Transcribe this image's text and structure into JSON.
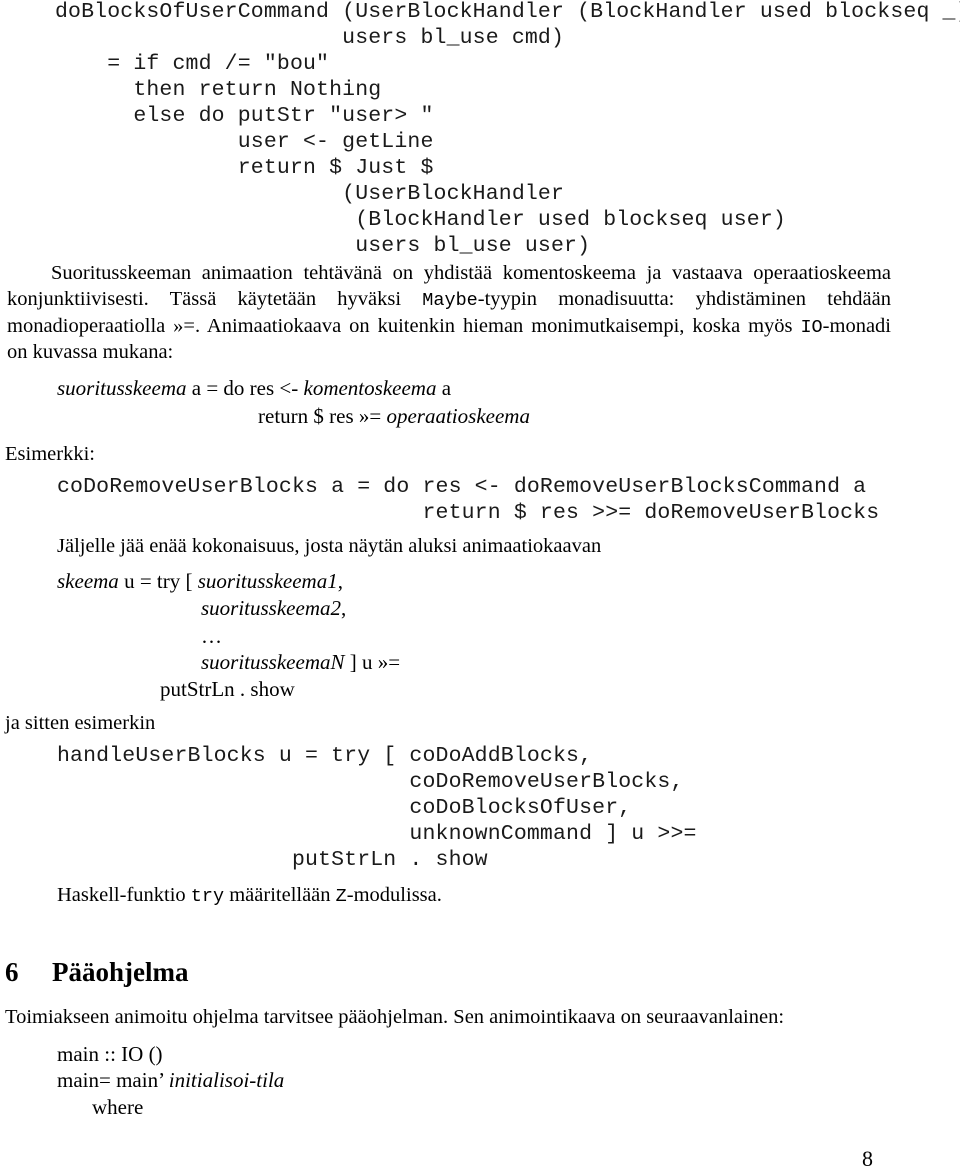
{
  "document": {
    "language": "fi",
    "page_number": "8"
  },
  "code_block_1": {
    "name": "doBlocksOfUserCommand-definition",
    "lines": [
      "doBlocksOfUserCommand (UserBlockHandler (BlockHandler used blockseq _)",
      "                      users bl_use cmd)",
      "    = if cmd /= \"bou\"",
      "      then return Nothing",
      "      else do putStr \"user> \"",
      "              user <- getLine",
      "              return $ Just $",
      "                      (UserBlockHandler",
      "                       (BlockHandler used blockseq user)",
      "                       users bl_use user)"
    ]
  },
  "paragraph_1": {
    "segments": [
      {
        "type": "text",
        "value": "Suoritusskeeman animaation tehtävänä on yhdistää komentoskeema ja vastaava operaatioskeema konjunktiivisesti. Tässä käytetään hyväksi "
      },
      {
        "type": "mono",
        "value": "Maybe"
      },
      {
        "type": "text",
        "value": "-tyypin monadisuutta: yhdistäminen tehdään monadioperaatiolla »=. Animaatiokaava on kuitenkin hieman monimutkaisempi, koska myös "
      },
      {
        "type": "mono",
        "value": "IO"
      },
      {
        "type": "text",
        "value": "-monadi on kuvassa mukana:"
      }
    ],
    "plain": "Suoritusskeeman animaation tehtävänä on yhdistää komentoskeema ja vastaava operaatioskeema konjunktiivisesti. Tässä käytetään hyväksi Maybe-tyypin monadisuutta: yhdistäminen tehdään monadioperaatiolla »=. Animaatiokaava on kuitenkin hieman monimutkaisempi, koska myös IO-monadi on kuvassa mukana:"
  },
  "formula_1": {
    "name": "suoritusskeema-formula",
    "line_1": {
      "part_a_italic": "suoritusskeema",
      "part_b": " a = do res <- ",
      "part_c_italic": "komentoskeema",
      "part_d": " a"
    },
    "line_2": {
      "part_a": "return $ res »= ",
      "part_b_italic": "operaatioskeema"
    }
  },
  "label_esimerkki": "Esimerkki:",
  "code_block_2": {
    "name": "coDoRemoveUserBlocks-example",
    "lines": [
      "coDoRemoveUserBlocks a = do res <- doRemoveUserBlocksCommand a",
      "                            return $ res >>= doRemoveUserBlocks"
    ]
  },
  "paragraph_2": {
    "text": "Jäljelle jää enää kokonaisuus, josta näytän aluksi animaatiokaavan"
  },
  "formula_2": {
    "name": "skeema-formula",
    "lines": [
      {
        "italic_head": "skeema",
        "rest": " u = try [ ",
        "italic_tail": "suoritusskeema1",
        "suffix": ","
      },
      {
        "italic_head": "",
        "rest": "",
        "italic_tail": "suoritusskeema2",
        "suffix": ","
      },
      {
        "italic_head": "",
        "rest": "",
        "italic_tail": "…",
        "suffix": ""
      },
      {
        "italic_head": "",
        "rest": "",
        "italic_tail": "suoritusskeemaN",
        "suffix": " ] u »="
      },
      {
        "italic_head": "",
        "rest": "putStrLn . show",
        "italic_tail": "",
        "suffix": ""
      }
    ]
  },
  "paragraph_3": {
    "text": "ja sitten esimerkin"
  },
  "code_block_3": {
    "name": "handleUserBlocks-example",
    "lines": [
      "handleUserBlocks u = try [ coDoAddBlocks,",
      "                           coDoRemoveUserBlocks,",
      "                           coDoBlocksOfUser,",
      "                           unknownCommand ] u >>=",
      "                  putStrLn . show"
    ]
  },
  "paragraph_4": {
    "segments": [
      {
        "type": "text",
        "value": "Haskell-funktio "
      },
      {
        "type": "mono",
        "value": "try"
      },
      {
        "type": "text",
        "value": " määritellään "
      },
      {
        "type": "mono",
        "value": "Z"
      },
      {
        "type": "text",
        "value": "-modulissa."
      }
    ],
    "plain": "Haskell-funktio try määritellään Z-modulissa."
  },
  "section": {
    "number": "6",
    "title": "Pääohjelma"
  },
  "paragraph_5": {
    "text": "Toimiakseen animoitu ohjelma tarvitsee pääohjelman. Sen animointikaava on seuraavanlainen:"
  },
  "formula_3": {
    "name": "main-formula",
    "line_1": "main :: IO ()",
    "line_2_plain": "main= main’ ",
    "line_2_italic": "initialisoi-tila",
    "line_3": "where"
  }
}
